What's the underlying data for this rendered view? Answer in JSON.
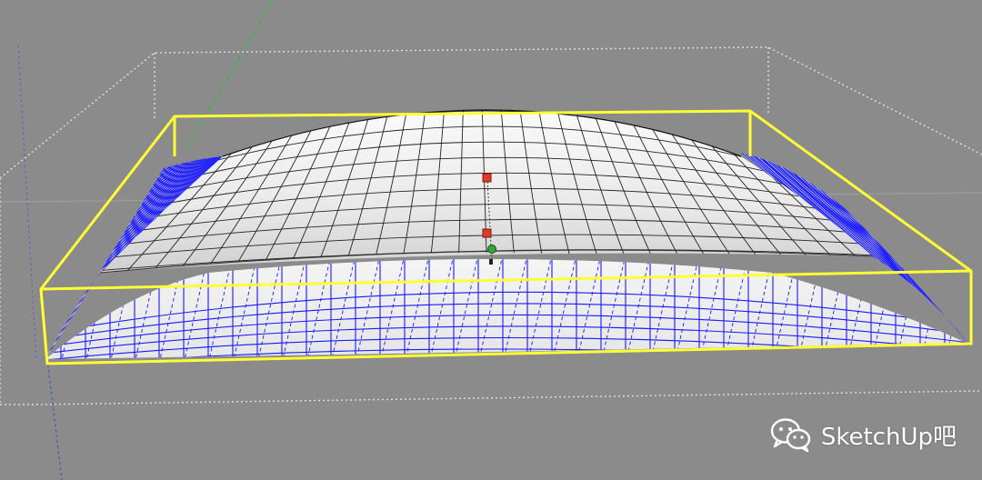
{
  "viewport": {
    "background": "#8b8b8b",
    "colors": {
      "selection_box": "#ffff33",
      "mesh_edges": "#1a1aff",
      "mesh_grid": "#222222",
      "surface": "#e8e8e8",
      "bounding_box": "#dddddd",
      "axis_green": "#2bbf3a",
      "axis_blue": "#3b49d6",
      "control_point": "#e23a2a",
      "pivot_point": "#2fa83a"
    },
    "icons": [
      "wechat-logo"
    ]
  },
  "watermark": {
    "text": "SketchUp吧"
  }
}
